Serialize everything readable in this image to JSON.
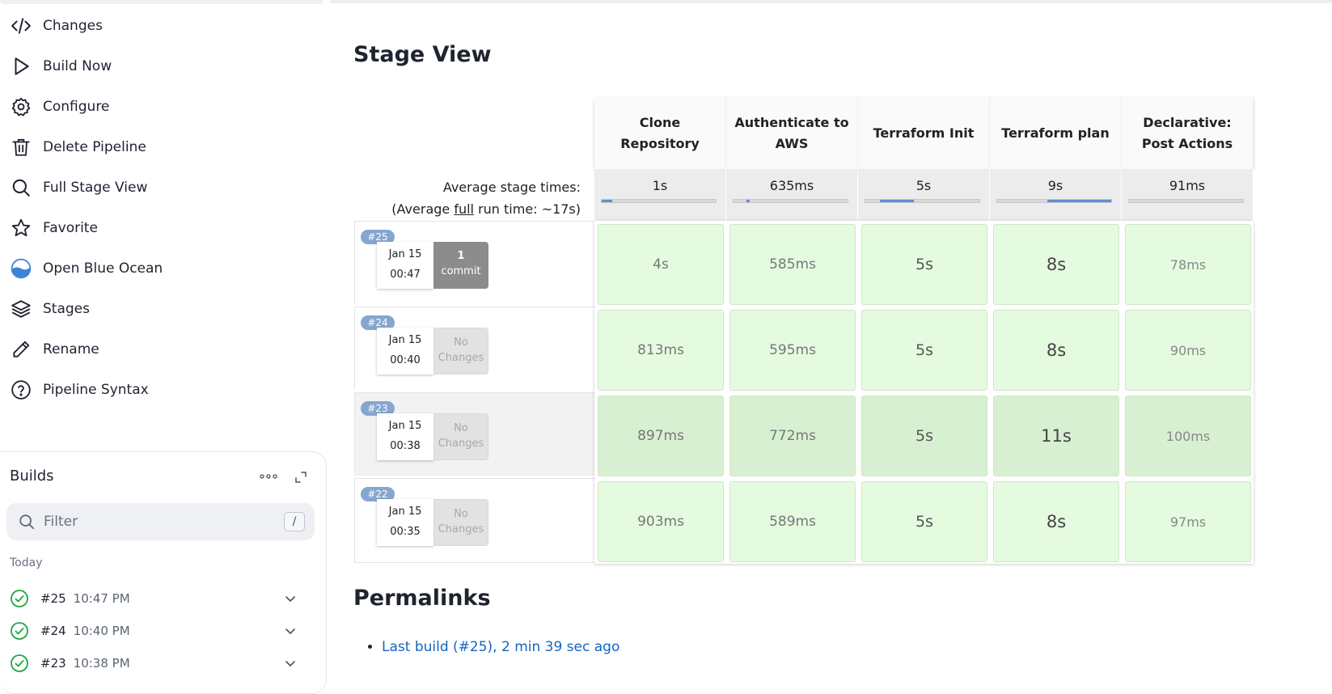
{
  "sidebar": {
    "items": [
      {
        "label": "Changes",
        "icon": "code-icon"
      },
      {
        "label": "Build Now",
        "icon": "play-icon"
      },
      {
        "label": "Configure",
        "icon": "gear-icon"
      },
      {
        "label": "Delete Pipeline",
        "icon": "trash-icon"
      },
      {
        "label": "Full Stage View",
        "icon": "search-icon"
      },
      {
        "label": "Favorite",
        "icon": "star-icon"
      },
      {
        "label": "Open Blue Ocean",
        "icon": "blue-ocean-icon"
      },
      {
        "label": "Stages",
        "icon": "layers-icon"
      },
      {
        "label": "Rename",
        "icon": "pencil-icon"
      },
      {
        "label": "Pipeline Syntax",
        "icon": "help-icon"
      }
    ]
  },
  "builds": {
    "title": "Builds",
    "filter_placeholder": "Filter",
    "filter_shortcut": "/",
    "group_label": "Today",
    "rows": [
      {
        "number": "#25",
        "time": "10:47 PM"
      },
      {
        "number": "#24",
        "time": "10:40 PM"
      },
      {
        "number": "#23",
        "time": "10:38 PM"
      }
    ]
  },
  "stage_view": {
    "title": "Stage View",
    "avg_label_line1": "Average stage times:",
    "avg_label_prefix": "(Average ",
    "avg_label_full": "full",
    "avg_label_suffix": " run time: ~17s)",
    "stages": [
      {
        "name": "Clone Repository",
        "avg": "1s"
      },
      {
        "name": "Authenticate to AWS",
        "avg": "635ms"
      },
      {
        "name": "Terraform Init",
        "avg": "5s"
      },
      {
        "name": "Terraform plan",
        "avg": "9s"
      },
      {
        "name": "Declarative: Post Actions",
        "avg": "91ms"
      }
    ],
    "runs": [
      {
        "badge": "#25",
        "date": "Jan 15",
        "time": "00:47",
        "changes_count": "1",
        "changes_label": "commit",
        "cells": [
          "4s",
          "585ms",
          "5s",
          "8s",
          "78ms"
        ]
      },
      {
        "badge": "#24",
        "date": "Jan 15",
        "time": "00:40",
        "changes_count": "No",
        "changes_label": "Changes",
        "cells": [
          "813ms",
          "595ms",
          "5s",
          "8s",
          "90ms"
        ]
      },
      {
        "badge": "#23",
        "date": "Jan 15",
        "time": "00:38",
        "changes_count": "No",
        "changes_label": "Changes",
        "cells": [
          "897ms",
          "772ms",
          "5s",
          "11s",
          "100ms"
        ]
      },
      {
        "badge": "#22",
        "date": "Jan 15",
        "time": "00:35",
        "changes_count": "No",
        "changes_label": "Changes",
        "cells": [
          "903ms",
          "589ms",
          "5s",
          "8s",
          "97ms"
        ]
      }
    ]
  },
  "permalinks": {
    "title": "Permalinks",
    "links": [
      "Last build (#25), 2 min 39 sec ago"
    ]
  },
  "colors": {
    "accent": "#1565c0",
    "success": "#1ea446",
    "stage_cell": "#e5fbe0",
    "badge": "#85a6cf"
  }
}
